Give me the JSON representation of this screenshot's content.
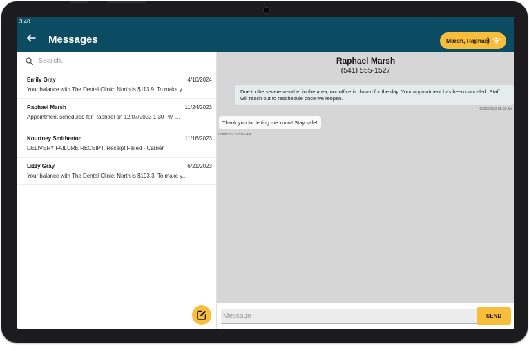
{
  "status_bar": {
    "time": "3:40"
  },
  "header": {
    "title": "Messages",
    "contact_chip": "Marsh, Raphael"
  },
  "search": {
    "placeholder": "Search..."
  },
  "conversations": [
    {
      "name": "Emily Gray",
      "date": "4/10/2024",
      "preview": "Your balance with The Dental Clinic: North is $113.9. To make y..."
    },
    {
      "name": "Raphael Marsh",
      "date": "11/24/2023",
      "preview": "Appointment scheduled for Raphael on 12/07/2023 1:30 PM ..."
    },
    {
      "name": "Kourtney Smitherton",
      "date": "11/16/2023",
      "preview": "DELIVERY FAILURE RECEIPT. Receipt Failed - Carrier"
    },
    {
      "name": "Lizzy Gray",
      "date": "6/21/2023",
      "preview": "Your balance with The Dental Clinic: North is $193.3. To make y..."
    }
  ],
  "thread": {
    "contact_name": "Raphael Marsh",
    "contact_phone": "(541) 555-1527",
    "messages": [
      {
        "text": "Due to the severe weather in the area, our office is closed for the day. Your appointment has been canceled. Staff will reach out to reschedule once we reopen.",
        "timestamp": "05/05/2023 08:03 AM"
      },
      {
        "text": "Thank you for letting me know! Stay safe!",
        "timestamp": "05/05/2023 08:03 AM"
      }
    ]
  },
  "composer": {
    "placeholder": "Message",
    "send_label": "SEND"
  },
  "colors": {
    "header": "#0b4c63",
    "accent": "#f7bd3b",
    "thread_bg": "#d6d6d6"
  }
}
